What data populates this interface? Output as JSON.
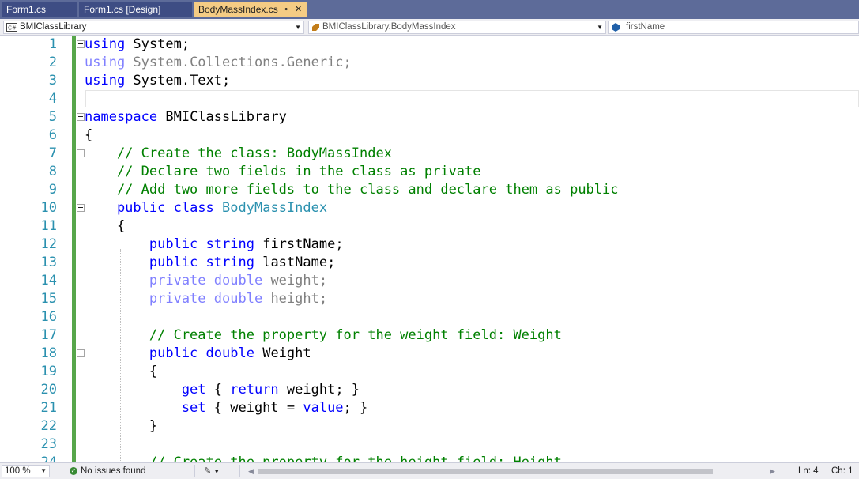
{
  "tabs": [
    {
      "label": "Form1.cs",
      "active": false
    },
    {
      "label": "Form1.cs [Design]",
      "active": false
    },
    {
      "label": "BodyMassIndex.cs",
      "active": true,
      "pin_icon": "pin-icon",
      "close_icon": "close-icon"
    }
  ],
  "navbar": {
    "project": "BMIClassLibrary",
    "type": "BMIClassLibrary.BodyMassIndex",
    "member": "firstName",
    "project_icon": "csharp-project-icon",
    "type_icon": "class-icon",
    "member_icon": "field-icon"
  },
  "editor": {
    "lines": [
      {
        "num": "1",
        "tokens": [
          {
            "t": "using",
            "c": "kw"
          },
          {
            "t": " System;",
            "c": "tx"
          }
        ]
      },
      {
        "num": "2",
        "tokens": [
          {
            "t": "using",
            "c": "kw-dim"
          },
          {
            "t": " System.Collections.Generic;",
            "c": "tx-dim"
          }
        ]
      },
      {
        "num": "3",
        "tokens": [
          {
            "t": "using",
            "c": "kw"
          },
          {
            "t": " System.Text;",
            "c": "tx"
          }
        ]
      },
      {
        "num": "4",
        "tokens": []
      },
      {
        "num": "5",
        "tokens": [
          {
            "t": "namespace",
            "c": "kw"
          },
          {
            "t": " BMIClassLibrary",
            "c": "tx"
          }
        ]
      },
      {
        "num": "6",
        "tokens": [
          {
            "t": "{",
            "c": "tx"
          }
        ]
      },
      {
        "num": "7",
        "tokens": [
          {
            "t": "    // Create the class: BodyMassIndex",
            "c": "cm"
          }
        ]
      },
      {
        "num": "8",
        "tokens": [
          {
            "t": "    // Declare two fields in the class as private",
            "c": "cm"
          }
        ]
      },
      {
        "num": "9",
        "tokens": [
          {
            "t": "    // Add two more fields to the class and declare them as public",
            "c": "cm"
          }
        ]
      },
      {
        "num": "10",
        "tokens": [
          {
            "t": "    public",
            "c": "kw"
          },
          {
            "t": " ",
            "c": "tx"
          },
          {
            "t": "class",
            "c": "kw"
          },
          {
            "t": " ",
            "c": "tx"
          },
          {
            "t": "BodyMassIndex",
            "c": "ty"
          }
        ]
      },
      {
        "num": "11",
        "tokens": [
          {
            "t": "    {",
            "c": "tx"
          }
        ]
      },
      {
        "num": "12",
        "tokens": [
          {
            "t": "        public",
            "c": "kw"
          },
          {
            "t": " ",
            "c": "tx"
          },
          {
            "t": "string",
            "c": "kw"
          },
          {
            "t": " firstName;",
            "c": "tx"
          }
        ]
      },
      {
        "num": "13",
        "tokens": [
          {
            "t": "        public",
            "c": "kw"
          },
          {
            "t": " ",
            "c": "tx"
          },
          {
            "t": "string",
            "c": "kw"
          },
          {
            "t": " lastName;",
            "c": "tx"
          }
        ]
      },
      {
        "num": "14",
        "tokens": [
          {
            "t": "        private",
            "c": "kw-dim"
          },
          {
            "t": " ",
            "c": "tx"
          },
          {
            "t": "double",
            "c": "kw-dim"
          },
          {
            "t": " weight;",
            "c": "tx-dim"
          }
        ]
      },
      {
        "num": "15",
        "tokens": [
          {
            "t": "        private",
            "c": "kw-dim"
          },
          {
            "t": " ",
            "c": "tx"
          },
          {
            "t": "double",
            "c": "kw-dim"
          },
          {
            "t": " height;",
            "c": "tx-dim"
          }
        ]
      },
      {
        "num": "16",
        "tokens": []
      },
      {
        "num": "17",
        "tokens": [
          {
            "t": "        // Create the property for the weight field: Weight",
            "c": "cm"
          }
        ]
      },
      {
        "num": "18",
        "tokens": [
          {
            "t": "        public",
            "c": "kw"
          },
          {
            "t": " ",
            "c": "tx"
          },
          {
            "t": "double",
            "c": "kw"
          },
          {
            "t": " Weight",
            "c": "tx"
          }
        ]
      },
      {
        "num": "19",
        "tokens": [
          {
            "t": "        {",
            "c": "tx"
          }
        ]
      },
      {
        "num": "20",
        "tokens": [
          {
            "t": "            get",
            "c": "kw"
          },
          {
            "t": " { ",
            "c": "tx"
          },
          {
            "t": "return",
            "c": "kw"
          },
          {
            "t": " weight; }",
            "c": "tx"
          }
        ]
      },
      {
        "num": "21",
        "tokens": [
          {
            "t": "            set",
            "c": "kw"
          },
          {
            "t": " { weight = ",
            "c": "tx"
          },
          {
            "t": "value",
            "c": "kw"
          },
          {
            "t": "; }",
            "c": "tx"
          }
        ]
      },
      {
        "num": "22",
        "tokens": [
          {
            "t": "        }",
            "c": "tx"
          }
        ]
      },
      {
        "num": "23",
        "tokens": []
      },
      {
        "num": "24",
        "tokens": [
          {
            "t": "        // Create the property for the height field: Height",
            "c": "cm"
          }
        ]
      }
    ]
  },
  "statusbar": {
    "zoom": "100 %",
    "issues": "No issues found",
    "issues_icon": "check-circle-icon",
    "brush_icon": "code-cleanup-icon",
    "ln": "Ln: 4",
    "ch": "Ch: 1"
  },
  "colors": {
    "tabbar": "#5d6b99",
    "active_tab": "#f5cc84",
    "keyword": "#0000ff",
    "comment": "#008000",
    "type": "#2b91af",
    "line_number": "#2b91af",
    "change_bar": "#57a64a"
  }
}
